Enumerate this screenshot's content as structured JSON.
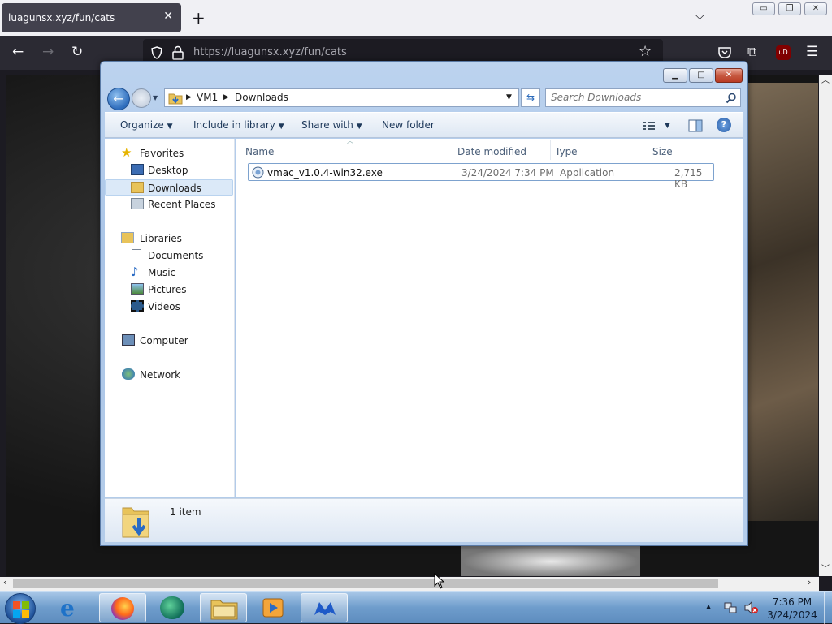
{
  "browser": {
    "tab_title": "luagunsx.xyz/fun/cats",
    "tab_close": "✕",
    "new_tab": "+",
    "list_tabs": "⌵",
    "url_host": "https://luagunsx.xyz",
    "url_path": "/fun/cats",
    "window_minimize": "▭",
    "window_restore": "❐",
    "window_close": "✕",
    "extension_badge": "uD"
  },
  "explorer": {
    "caption_minimize": "▁",
    "caption_maximize": "□",
    "caption_close": "✕",
    "breadcrumb": [
      "VM1",
      "Downloads"
    ],
    "search_placeholder": "Search Downloads",
    "toolbar": {
      "organize": "Organize",
      "include_in_library": "Include in library",
      "share_with": "Share with",
      "new_folder": "New folder",
      "help": "?"
    },
    "nav": {
      "favorites": "Favorites",
      "desktop": "Desktop",
      "downloads": "Downloads",
      "recent_places": "Recent Places",
      "libraries": "Libraries",
      "documents": "Documents",
      "music": "Music",
      "pictures": "Pictures",
      "videos": "Videos",
      "computer": "Computer",
      "network": "Network"
    },
    "columns": {
      "name": "Name",
      "date_modified": "Date modified",
      "type": "Type",
      "size": "Size"
    },
    "files": [
      {
        "name": "vmac_v1.0.4-win32.exe",
        "date_modified": "3/24/2024 7:34 PM",
        "type": "Application",
        "size": "2,715 KB"
      }
    ],
    "status": "1 item"
  },
  "taskbar": {
    "time": "7:36 PM",
    "date": "3/24/2024",
    "tray_arrow": "▲"
  }
}
